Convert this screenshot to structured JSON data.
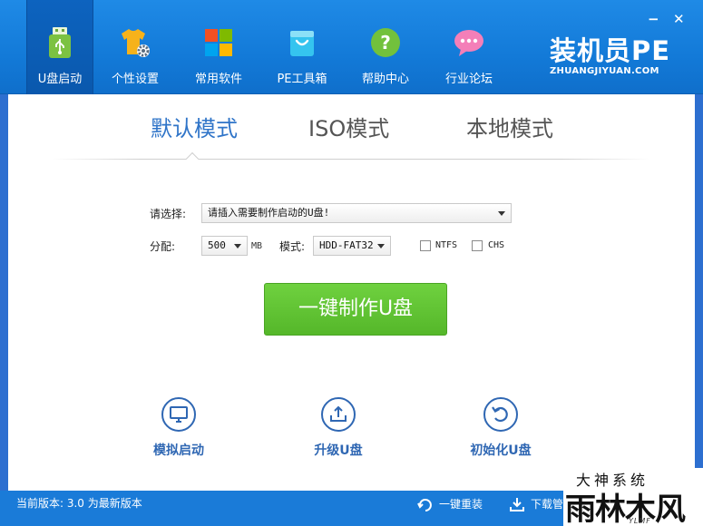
{
  "window": {
    "minimize_glyph": "−",
    "close_glyph": "✕"
  },
  "nav": {
    "items": [
      {
        "label": "U盘启动",
        "icon": "usb-drive-icon",
        "active": true
      },
      {
        "label": "个性设置",
        "icon": "tshirt-gear-icon",
        "active": false
      },
      {
        "label": "常用软件",
        "icon": "windows-tiles-icon",
        "active": false
      },
      {
        "label": "PE工具箱",
        "icon": "shopping-bag-icon",
        "active": false
      },
      {
        "label": "帮助中心",
        "icon": "question-mark-icon",
        "active": false
      },
      {
        "label": "行业论坛",
        "icon": "chat-bubble-icon",
        "active": false
      }
    ]
  },
  "brand": {
    "title": "装机员PE",
    "subtitle": "ZHUANGJIYUAN.COM"
  },
  "modes": [
    {
      "label": "默认模式",
      "active": true
    },
    {
      "label": "ISO模式",
      "active": false
    },
    {
      "label": "本地模式",
      "active": false
    }
  ],
  "form": {
    "select_label": "请选择:",
    "select_value": "请插入需要制作启动的U盘!",
    "partition_label": "分配:",
    "partition_value": "500",
    "partition_unit": "MB",
    "mode_label": "模式:",
    "mode_value": "HDD-FAT32",
    "ntfs_label": "NTFS",
    "chs_label": "CHS",
    "ntfs_checked": false,
    "chs_checked": false
  },
  "make_button": "一键制作U盘",
  "tools": [
    {
      "label": "模拟启动",
      "icon": "monitor-icon"
    },
    {
      "label": "升级U盘",
      "icon": "upload-tray-icon"
    },
    {
      "label": "初始化U盘",
      "icon": "restore-arrow-icon"
    }
  ],
  "status": {
    "version": "当前版本: 3.0 为最新版本",
    "reinstall": "一键重装",
    "download": "下载管"
  },
  "watermark": {
    "top": "大神系统",
    "main": "雨林木风",
    "sub": "YLMF"
  },
  "colors": {
    "header_blue": "#137ad8",
    "accent_blue": "#2f74c8",
    "green_button": "#5cbf2f"
  }
}
